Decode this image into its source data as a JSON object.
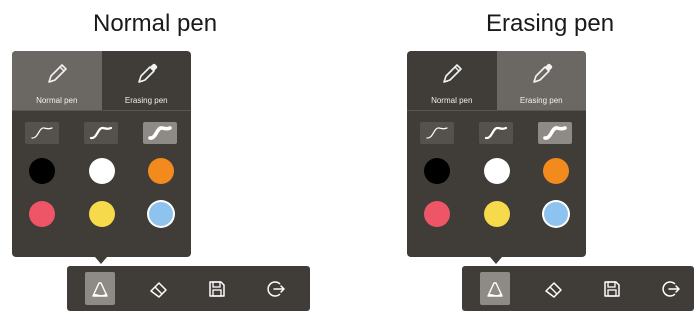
{
  "headings": {
    "left": "Normal pen",
    "right": "Erasing pen"
  },
  "panel": {
    "tabs": [
      {
        "label": "Normal pen",
        "icon": "pen-icon"
      },
      {
        "label": "Erasing pen",
        "icon": "eraser-pen-icon"
      }
    ],
    "stroke_widths": [
      "thin",
      "medium",
      "thick"
    ],
    "colors": [
      "#000000",
      "#ffffff",
      "#f38a1e",
      "#ee5566",
      "#f6da4b",
      "#8ec3ef"
    ]
  },
  "states": {
    "left": {
      "active_tab": "Normal pen",
      "selected_stroke": "thick",
      "selected_color": "#8ec3ef"
    },
    "right": {
      "active_tab": "Erasing pen",
      "selected_stroke": "thick",
      "selected_color": "#8ec3ef"
    }
  },
  "toolbar": {
    "items": [
      "pen-tool-icon",
      "eraser-icon",
      "save-icon",
      "exit-icon"
    ],
    "active": "pen-tool-icon"
  },
  "theme": {
    "panel_bg": "#403c37",
    "active_bg": "#8e8a85"
  }
}
